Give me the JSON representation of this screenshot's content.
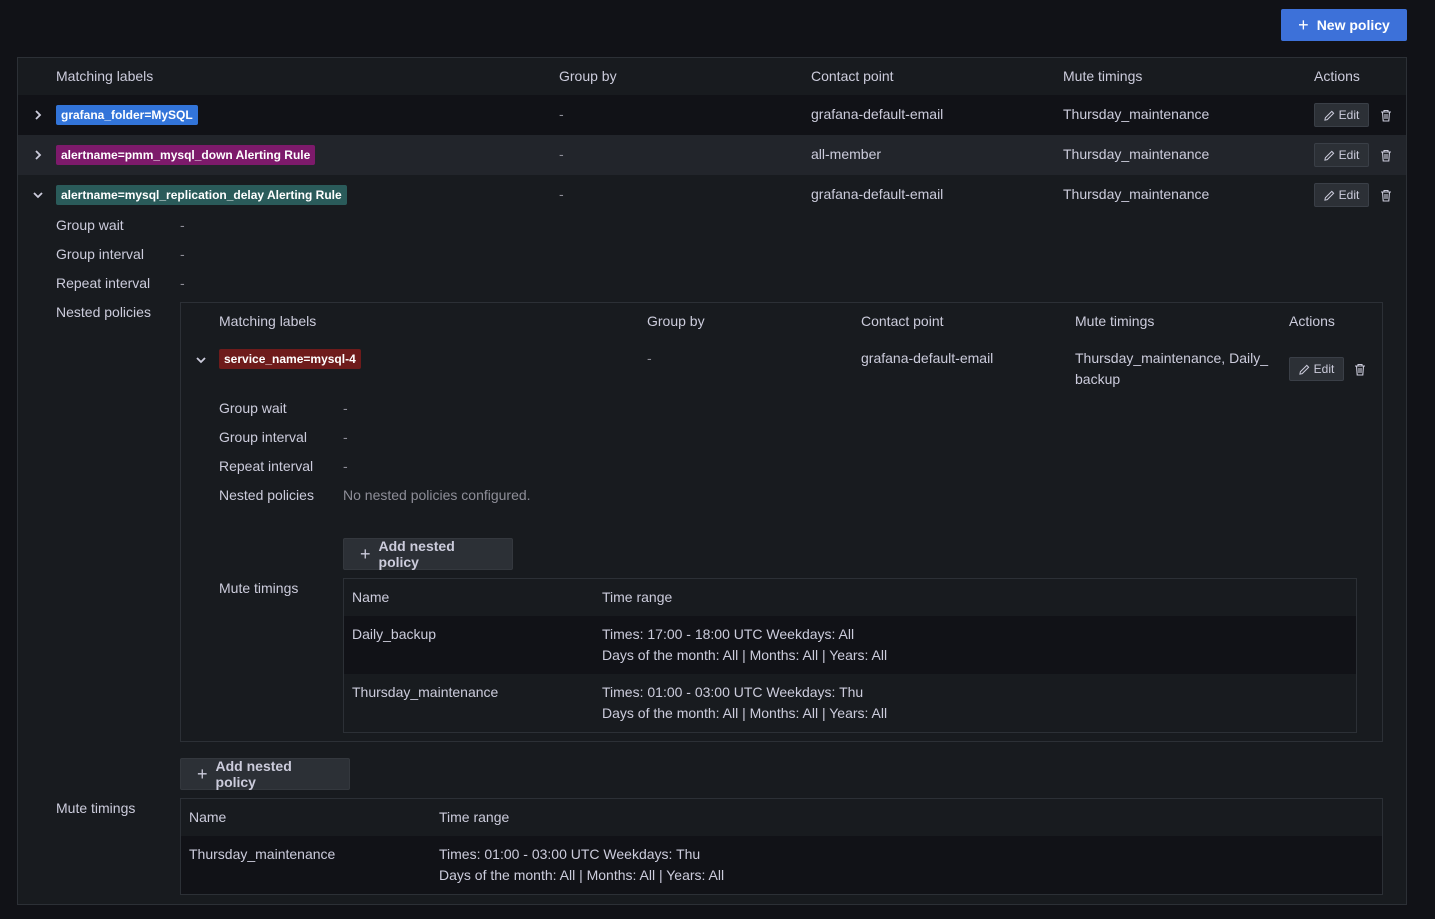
{
  "toolbar": {
    "new_policy_label": "New policy"
  },
  "columns": {
    "matching_labels": "Matching labels",
    "group_by": "Group by",
    "contact_point": "Contact point",
    "mute_timings": "Mute timings",
    "actions": "Actions"
  },
  "rows": [
    {
      "label": "grafana_folder=MySQL",
      "label_color": "#3274d9",
      "group_by": "-",
      "contact_point": "grafana-default-email",
      "mute_timings": "Thursday_maintenance",
      "edit_label": "Edit"
    },
    {
      "label": "alertname=pmm_mysql_down Alerting Rule",
      "label_color": "#7d1a6b",
      "group_by": "-",
      "contact_point": "all-member",
      "mute_timings": "Thursday_maintenance",
      "edit_label": "Edit"
    },
    {
      "label": "alertname=mysql_replication_delay Alerting Rule",
      "label_color": "#2a5b5a",
      "group_by": "-",
      "contact_point": "grafana-default-email",
      "mute_timings": "Thursday_maintenance",
      "edit_label": "Edit"
    }
  ],
  "details": {
    "group_wait_label": "Group wait",
    "group_wait_value": "-",
    "group_interval_label": "Group interval",
    "group_interval_value": "-",
    "repeat_interval_label": "Repeat interval",
    "repeat_interval_value": "-",
    "nested_policies_label": "Nested policies",
    "mute_timings_label": "Mute timings",
    "add_nested_label": "Add nested policy"
  },
  "nested": {
    "label": "service_name=mysql-4",
    "label_color": "#6e1b1b",
    "group_by": "-",
    "contact_point": "grafana-default-email",
    "mute_timings_line1": "Thursday_maintenance, Daily_",
    "mute_timings_line2": "backup",
    "edit_label": "Edit",
    "group_wait_value": "-",
    "group_interval_value": "-",
    "repeat_interval_value": "-",
    "no_nested": "No nested policies configured.",
    "mute_table": {
      "name_header": "Name",
      "range_header": "Time range",
      "rows": [
        {
          "name": "Daily_backup",
          "line1": "Times: 17:00 - 18:00 UTC Weekdays: All",
          "line2": "Days of the month: All | Months: All | Years: All"
        },
        {
          "name": "Thursday_maintenance",
          "line1": "Times: 01:00 - 03:00 UTC Weekdays: Thu",
          "line2": "Days of the month: All | Months: All | Years: All"
        }
      ]
    }
  },
  "root_mute_table": {
    "name_header": "Name",
    "range_header": "Time range",
    "rows": [
      {
        "name": "Thursday_maintenance",
        "line1": "Times: 01:00 - 03:00 UTC Weekdays: Thu",
        "line2": "Days of the month: All | Months: All | Years: All"
      }
    ]
  },
  "icons": {
    "expand": "chevron-right-icon",
    "collapse": "chevron-down-icon",
    "edit": "pen-icon",
    "delete": "trash-icon",
    "add": "plus-icon"
  }
}
